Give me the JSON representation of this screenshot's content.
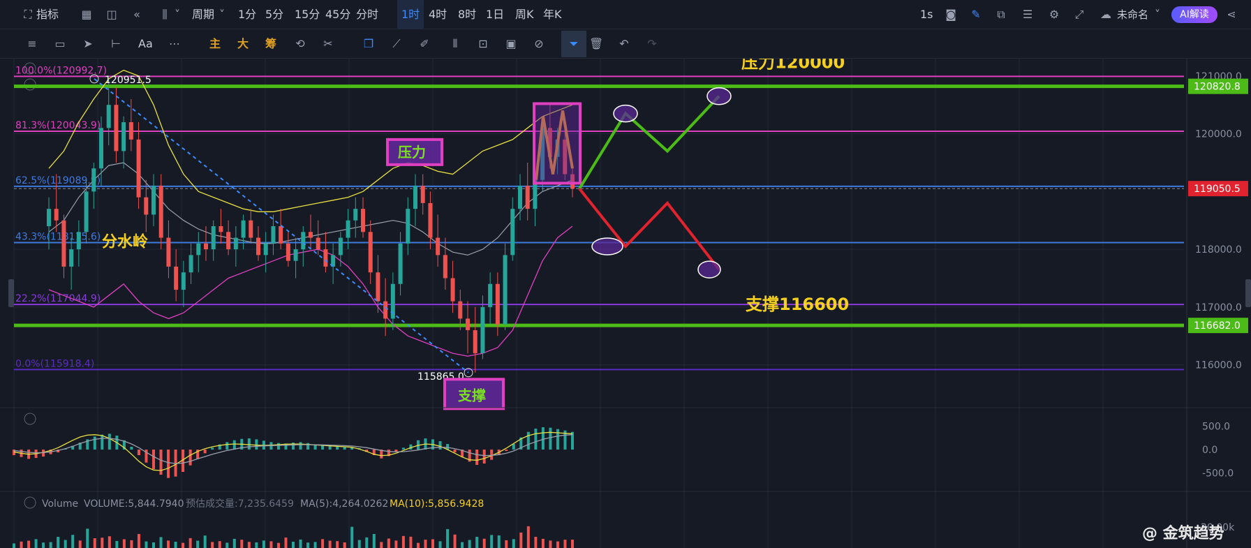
{
  "topbar": {
    "indicator_label": "指标",
    "period_label": "周期",
    "intervals": [
      "1分",
      "5分",
      "15分",
      "45分",
      "分时",
      "1时",
      "4时",
      "8时",
      "1日",
      "周K",
      "年K"
    ],
    "active_interval": "1时",
    "speed_label": "1s",
    "layout_name": "未命名",
    "ai_button": "AI解读"
  },
  "toolbar2": {
    "text_tool": "Aa",
    "chip_main": "主",
    "chip_big": "大",
    "chip_chips": "筹"
  },
  "colors": {
    "background": "#161a25",
    "grid": "#232838",
    "green_line": "#4cbb17",
    "magenta_line": "#e040c0",
    "blue_line": "#3d7be0",
    "purple_line": "#8a3be0",
    "violet_line": "#5a2cc0",
    "yellow_text": "#f5d020",
    "up_candle": "#26a69a",
    "down_candle": "#ef5350",
    "price_tag": "#e0232e",
    "accent_blue": "#3b8cff"
  },
  "chart_data": [
    {
      "type": "candlestick",
      "timeframe": "1时",
      "ylim": [
        115500,
        121300
      ],
      "y_ticks": [
        "121000.0",
        "120000.0",
        "118000.0",
        "117000.0",
        "116000.0"
      ],
      "price_tags": [
        {
          "value": 120820.8,
          "label": "120820.8",
          "color": "#4cbb17"
        },
        {
          "value": 119050.5,
          "label": "119050.5",
          "color": "#e0232e"
        },
        {
          "value": 116682.0,
          "label": "116682.0",
          "color": "#4cbb17"
        }
      ],
      "fib_levels": [
        {
          "label": "100.0%(120992.7)",
          "value": 120992.7,
          "color": "#e040c0"
        },
        {
          "label": "81.3%(120043.9)",
          "value": 120043.9,
          "color": "#e040c0"
        },
        {
          "label": "62.5%(119089.9)",
          "value": 119089.9,
          "color": "#3d7be0"
        },
        {
          "label": "43.3%(118115.6)",
          "value": 118115.6,
          "color": "#3d7be0"
        },
        {
          "label": "22.2%(117044.9)",
          "value": 117044.9,
          "color": "#8a3be0"
        },
        {
          "label": "0.0%(115918.4)",
          "value": 115918.4,
          "color": "#5a2cc0"
        }
      ],
      "extreme_labels": [
        {
          "label": "120951.5",
          "value": 120951.5
        },
        {
          "label": "115865.0",
          "value": 115865.0
        }
      ],
      "annotations": {
        "resistance_top": "压力120000",
        "support_bottom": "支撑116600",
        "watershed": "分水岭",
        "resistance_box": "压力",
        "support_box": "支撑"
      },
      "candles": [
        [
          118400,
          118900,
          118000,
          118700
        ],
        [
          118700,
          119300,
          118300,
          118500
        ],
        [
          118500,
          118600,
          117500,
          117700
        ],
        [
          117700,
          118200,
          117300,
          118000
        ],
        [
          118000,
          118500,
          117700,
          118300
        ],
        [
          118300,
          119200,
          118100,
          119000
        ],
        [
          119000,
          119500,
          118700,
          119400
        ],
        [
          119400,
          120300,
          119100,
          120100
        ],
        [
          120100,
          120951.5,
          119800,
          120500
        ],
        [
          120500,
          120800,
          119500,
          119700
        ],
        [
          119700,
          120300,
          119400,
          120200
        ],
        [
          120200,
          120600,
          119700,
          119900
        ],
        [
          119900,
          120200,
          118700,
          118900
        ],
        [
          118900,
          119200,
          118300,
          118600
        ],
        [
          118600,
          119300,
          118400,
          119100
        ],
        [
          119100,
          119300,
          118000,
          118200
        ],
        [
          118200,
          118500,
          117500,
          117700
        ],
        [
          117700,
          118000,
          117100,
          117300
        ],
        [
          117300,
          117800,
          117000,
          117600
        ],
        [
          117600,
          118100,
          117400,
          117900
        ],
        [
          117900,
          118300,
          117600,
          118100
        ],
        [
          118100,
          118400,
          117800,
          118000
        ],
        [
          118000,
          118500,
          117800,
          118400
        ],
        [
          118400,
          118700,
          118100,
          118300
        ],
        [
          118300,
          118500,
          117900,
          118000
        ],
        [
          118000,
          118400,
          117700,
          118200
        ],
        [
          118200,
          118600,
          118000,
          118500
        ],
        [
          118500,
          118700,
          118100,
          118200
        ],
        [
          118200,
          118400,
          117800,
          117900
        ],
        [
          117900,
          118300,
          117600,
          118100
        ],
        [
          118100,
          118600,
          117900,
          118400
        ],
        [
          118400,
          118700,
          118000,
          118100
        ],
        [
          118100,
          118300,
          117700,
          117800
        ],
        [
          117800,
          118200,
          117500,
          118000
        ],
        [
          118000,
          118400,
          117700,
          118300
        ],
        [
          118300,
          118600,
          118000,
          118200
        ],
        [
          118200,
          118500,
          117900,
          118000
        ],
        [
          118000,
          118300,
          117600,
          117700
        ],
        [
          117700,
          118100,
          117400,
          117900
        ],
        [
          117900,
          118300,
          117700,
          118200
        ],
        [
          118200,
          118700,
          118000,
          118500
        ],
        [
          118500,
          118900,
          118200,
          118700
        ],
        [
          118700,
          118900,
          118200,
          118300
        ],
        [
          118300,
          118500,
          117400,
          117600
        ],
        [
          117600,
          117900,
          116900,
          117100
        ],
        [
          117100,
          117500,
          116500,
          116800
        ],
        [
          116800,
          117600,
          116600,
          117400
        ],
        [
          117400,
          118300,
          117200,
          118100
        ],
        [
          118100,
          118900,
          117900,
          118700
        ],
        [
          118700,
          119300,
          118400,
          119100
        ],
        [
          119100,
          119300,
          118600,
          118800
        ],
        [
          118800,
          119000,
          118000,
          118200
        ],
        [
          118200,
          118600,
          117700,
          117900
        ],
        [
          117900,
          118200,
          117300,
          117500
        ],
        [
          117500,
          117800,
          116900,
          117100
        ],
        [
          117100,
          117300,
          116600,
          116800
        ],
        [
          116800,
          117100,
          116200,
          116600
        ],
        [
          116600,
          117000,
          115865,
          116200
        ],
        [
          116200,
          117200,
          116100,
          117000
        ],
        [
          117000,
          117600,
          116700,
          117400
        ],
        [
          117400,
          117600,
          116500,
          116700
        ],
        [
          116700,
          118100,
          116600,
          117900
        ],
        [
          117900,
          118900,
          117800,
          118700
        ],
        [
          118700,
          119300,
          118500,
          119100
        ],
        [
          119100,
          119500,
          118500,
          118700
        ],
        [
          118700,
          119300,
          118400,
          119200
        ],
        [
          119200,
          120300,
          119000,
          120100
        ],
        [
          120100,
          120500,
          119400,
          119600
        ],
        [
          119600,
          120100,
          119300,
          119900
        ],
        [
          119900,
          120200,
          119200,
          119300
        ],
        [
          119300,
          119500,
          118900,
          119050.5
        ]
      ],
      "bollinger": {
        "upper": [
          119400,
          119700,
          120200,
          120600,
          120950,
          121100,
          121000,
          120500,
          119800,
          119300,
          119000,
          118900,
          118800,
          118700,
          118650,
          118650,
          118700,
          118750,
          118800,
          118850,
          118900,
          119000,
          119200,
          119400,
          119500,
          119450,
          119350,
          119300,
          119500,
          119700,
          119800,
          119900,
          120100,
          120300,
          120400,
          120500
        ],
        "middle": [
          118300,
          118500,
          118900,
          119200,
          119450,
          119500,
          119300,
          119000,
          118700,
          118500,
          118350,
          118250,
          118200,
          118150,
          118100,
          118100,
          118150,
          118200,
          118250,
          118300,
          118350,
          118400,
          118450,
          118500,
          118450,
          118300,
          118100,
          117950,
          117900,
          118000,
          118200,
          118500,
          118800,
          119000,
          119100,
          119200
        ],
        "lower": [
          117300,
          117200,
          117100,
          117000,
          117200,
          117400,
          117100,
          116900,
          116800,
          116900,
          117100,
          117300,
          117500,
          117600,
          117700,
          117800,
          117900,
          117950,
          118000,
          117900,
          117700,
          117400,
          117000,
          116700,
          116500,
          116400,
          116300,
          116200,
          116150,
          116200,
          116300,
          116600,
          117200,
          117800,
          118200,
          118400
        ]
      },
      "trend_line": {
        "from": 120951.5,
        "to": 115865.0,
        "style": "dashed"
      },
      "projection_up": [
        119050,
        120350,
        119700,
        120650
      ],
      "projection_down": [
        119050,
        118050,
        118800,
        117650
      ],
      "recent_zigzag": [
        119200,
        120300,
        119300,
        120400,
        119400
      ]
    },
    {
      "type": "bar",
      "name": "MACD",
      "y_ticks": [
        "500.0",
        "0.0",
        "-500.0"
      ],
      "ylim": [
        -750,
        750
      ],
      "histogram": [
        -120,
        -160,
        -200,
        -180,
        -150,
        -100,
        -60,
        20,
        80,
        150,
        220,
        280,
        320,
        340,
        300,
        200,
        60,
        -120,
        -280,
        -420,
        -540,
        -610,
        -580,
        -480,
        -340,
        -200,
        -80,
        40,
        110,
        160,
        200,
        230,
        240,
        220,
        190,
        160,
        140,
        130,
        150,
        160,
        140,
        110,
        90,
        70,
        60,
        50,
        40,
        30,
        -50,
        -120,
        -190,
        -140,
        -60,
        40,
        110,
        200,
        240,
        220,
        180,
        120,
        -60,
        -160,
        -260,
        -330,
        -300,
        -220,
        -120,
        -30,
        120,
        260,
        380,
        450,
        480,
        470,
        440,
        410,
        380
      ],
      "dif": [
        -50,
        -80,
        -100,
        -90,
        -60,
        -20,
        40,
        120,
        200,
        270,
        310,
        320,
        300,
        240,
        150,
        40,
        -100,
        -250,
        -370,
        -440,
        -450,
        -400,
        -320,
        -220,
        -120,
        -40,
        20,
        60,
        90,
        110,
        120,
        115,
        105,
        95,
        90,
        95,
        105,
        115,
        120,
        118,
        110,
        100,
        90,
        80,
        70,
        60,
        50,
        10,
        -40,
        -100,
        -130,
        -120,
        -80,
        -20,
        40,
        90,
        120,
        110,
        70,
        0,
        -80,
        -160,
        -220,
        -230,
        -190,
        -130,
        -60,
        30,
        130,
        230,
        300,
        340,
        360,
        370,
        360,
        350,
        340
      ],
      "dea": [
        -20,
        -40,
        -60,
        -70,
        -65,
        -50,
        -20,
        20,
        70,
        130,
        180,
        220,
        240,
        240,
        220,
        180,
        120,
        40,
        -60,
        -150,
        -230,
        -280,
        -300,
        -290,
        -250,
        -200,
        -150,
        -100,
        -60,
        -20,
        10,
        40,
        60,
        70,
        80,
        85,
        90,
        95,
        100,
        105,
        105,
        104,
        100,
        96,
        90,
        84,
        76,
        60,
        40,
        10,
        -20,
        -40,
        -50,
        -45,
        -30,
        -10,
        20,
        40,
        50,
        45,
        20,
        -20,
        -70,
        -110,
        -130,
        -125,
        -110,
        -80,
        -30,
        40,
        110,
        170,
        220,
        260,
        290,
        310,
        320
      ]
    },
    {
      "type": "bar",
      "name": "Volume",
      "legend": {
        "title": "Volume",
        "volume": "VOLUME:5,844.7940",
        "estimate": "预估成交量:7,235.6459",
        "ma5": "MA(5):4,264.0262",
        "ma10": "MA(10):5,856.9428"
      },
      "y_ticks": [
        "20.00k"
      ],
      "ylim": [
        0,
        20000
      ],
      "values": [
        3200,
        4500,
        5100,
        6200,
        3800,
        4100,
        7800,
        5600,
        9200,
        5200,
        13500,
        6800,
        7200,
        8200,
        4900,
        6100,
        5400,
        9800,
        4600,
        3900,
        7600,
        5200,
        4400,
        3600,
        6900,
        5100,
        8700,
        4200,
        4800,
        3700,
        6400,
        5800,
        4300,
        3900,
        5200,
        4700,
        3600,
        7300,
        4400,
        5900,
        3800,
        4200,
        6200,
        5100,
        4800,
        3900,
        14800,
        5600,
        7400,
        9800,
        4200,
        6600,
        5200,
        8400,
        7900,
        3600,
        5800,
        6100,
        4700,
        13200,
        9400,
        4100,
        5600,
        7800,
        6500,
        9100,
        8800,
        5400,
        6200,
        10800,
        15200,
        7800,
        6400,
        5200,
        4600,
        5800,
        5844.794
      ]
    }
  ],
  "watermark": "@ 金筑趋势"
}
